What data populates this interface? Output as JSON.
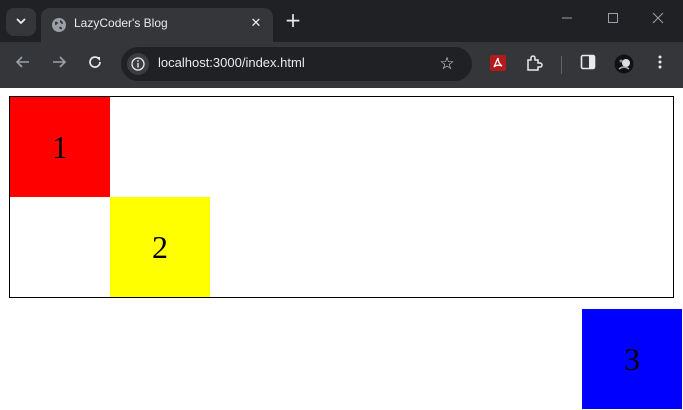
{
  "window": {
    "tab_title": "LazyCoder's Blog",
    "icons": {
      "tab_search": "chevron-down-icon",
      "favicon": "globe-icon",
      "close": "close-icon",
      "new_tab": "plus-icon",
      "minimize": "minimize-icon",
      "maximize": "maximize-icon",
      "close_window": "close-window-icon"
    }
  },
  "toolbar": {
    "url": "localhost:3000/index.html",
    "icons": [
      "back-icon",
      "forward-icon",
      "reload-icon",
      "site-info-icon",
      "star-icon",
      "pdf-extension-icon",
      "extensions-icon",
      "sidebar-icon",
      "profile-avatar",
      "menu-icon"
    ]
  },
  "page": {
    "boxes": [
      {
        "label": "1",
        "color": "#ff0000"
      },
      {
        "label": "2",
        "color": "#ffff00"
      },
      {
        "label": "3",
        "color": "#0000ff"
      }
    ]
  }
}
